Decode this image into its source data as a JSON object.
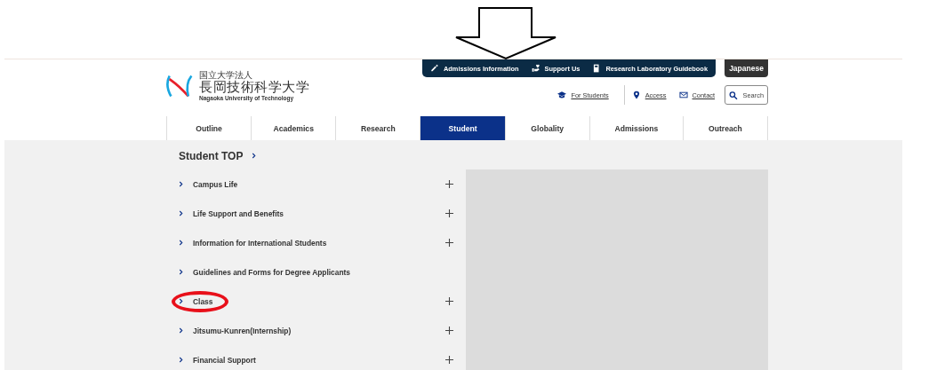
{
  "logo": {
    "small": "国立大学法人",
    "name": "長岡技術科学大学",
    "english": "Nagaoka University of Technology"
  },
  "top_bar": {
    "links": [
      {
        "label": "Admissions Information"
      },
      {
        "label": "Support Us"
      },
      {
        "label": "Research Laboratory Guidebook"
      }
    ],
    "language": "Japanese"
  },
  "utility_links": [
    {
      "label": "For Students"
    },
    {
      "label": "Access"
    },
    {
      "label": "Contact"
    }
  ],
  "search": {
    "label": "Search"
  },
  "tabs": [
    {
      "label": "Outline",
      "selected": false
    },
    {
      "label": "Academics",
      "selected": false
    },
    {
      "label": "Research",
      "selected": false
    },
    {
      "label": "Student",
      "selected": true
    },
    {
      "label": "Globality",
      "selected": false
    },
    {
      "label": "Admissions",
      "selected": false
    },
    {
      "label": "Outreach",
      "selected": false
    }
  ],
  "menu": {
    "title": "Student TOP",
    "items": [
      {
        "label": "Campus Life",
        "expandable": true,
        "circled": false
      },
      {
        "label": "Life Support and Benefits",
        "expandable": true,
        "circled": false
      },
      {
        "label": "Information for International Students",
        "expandable": true,
        "circled": false
      },
      {
        "label": "Guidelines and Forms for Degree Applicants",
        "expandable": false,
        "circled": false
      },
      {
        "label": "Class",
        "expandable": true,
        "circled": true
      },
      {
        "label": "Jitsumu-Kunren(Internship)",
        "expandable": true,
        "circled": false
      },
      {
        "label": "Financial Support",
        "expandable": true,
        "circled": false
      }
    ]
  }
}
